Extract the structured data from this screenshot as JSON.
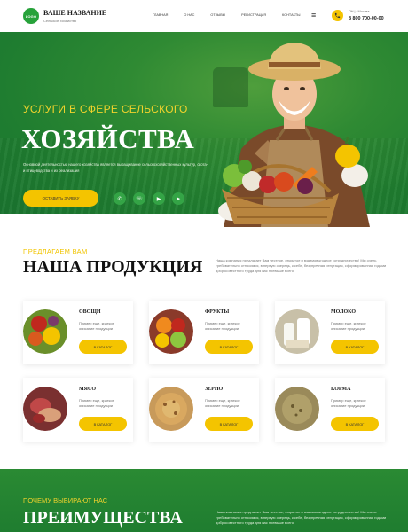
{
  "header": {
    "logo": "LOGO",
    "brand_name": "ВАШЕ НАЗВАНИЕ",
    "brand_sub": "Сельское хозяйство",
    "nav": [
      "Главная",
      "О нас",
      "Отзывы",
      "Регистрация",
      "Контакты"
    ],
    "city": "ПН | г.Москва",
    "phone": "8 800 700-00-00"
  },
  "hero": {
    "kicker": "УСЛУГИ В СФЕРЕ СЕЛЬСКОГО",
    "title": "ХОЗЯЙСТВА",
    "description": "Основной деятельностью нашего хозяйства является выращивание сельскохозяйственных культур, скота- и птицеводства и их реализация",
    "cta": "ОСТАВИТЬ ЗАЯВКУ",
    "socials": [
      "whatsapp-icon",
      "viber-icon",
      "youtube-icon",
      "telegram-icon"
    ]
  },
  "products": {
    "kicker": "ПРЕДЛАГАЕМ ВАМ",
    "title": "НАША ПРОДУКЦИЯ",
    "description": "Наша компания предлагает Вам честное, открытое и взаимовыгодное сотрудничество! Мы очень требовательно относимся, в первую очередь, к себе, безупречная репутация, сформированная годами добросовестного труда для нас превыше всего!",
    "items": [
      {
        "title": "ОВОЩИ",
        "desc": "Пример еще, краткое описание продукции",
        "btn": "В КАТАЛОГ"
      },
      {
        "title": "ФРУКТЫ",
        "desc": "Пример еще, краткое описание продукции",
        "btn": "В КАТАЛОГ"
      },
      {
        "title": "МОЛОКО",
        "desc": "Пример еще, краткое описание продукции",
        "btn": "В КАТАЛОГ"
      },
      {
        "title": "МЯСО",
        "desc": "Пример еще, краткое описание продукции",
        "btn": "В КАТАЛОГ"
      },
      {
        "title": "ЗЕРНО",
        "desc": "Пример еще, краткое описание продукции",
        "btn": "В КАТАЛОГ"
      },
      {
        "title": "КОРМА",
        "desc": "Пример еще, краткое описание продукции",
        "btn": "В КАТАЛОГ"
      }
    ]
  },
  "advantages": {
    "kicker": "ПОЧЕМУ ВЫБИРАЮТ НАС",
    "title": "ПРЕИМУЩЕСТВА",
    "description": "Наша компания предлагает Вам честное, открытое и взаимовыгодное сотрудничество! Мы очень требовательно относимся, в первую очередь, к себе, безупречная репутация, сформированная годами добросовестного труда для нас превыше всего!"
  }
}
